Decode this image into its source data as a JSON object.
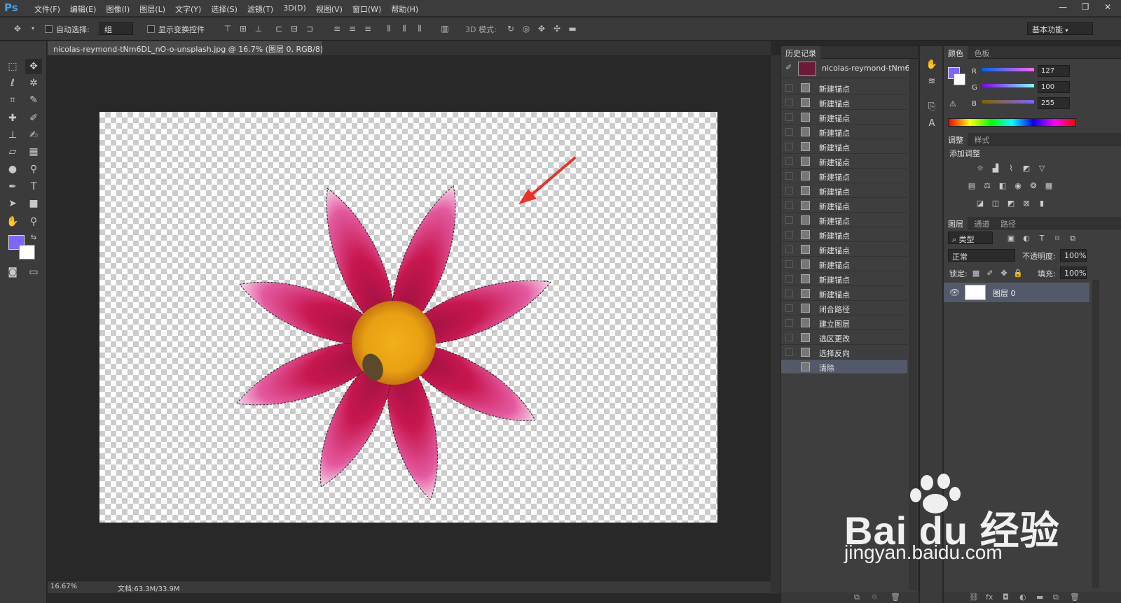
{
  "app": {
    "logo": "Ps"
  },
  "menu": [
    "文件(F)",
    "编辑(E)",
    "图像(I)",
    "图层(L)",
    "文字(Y)",
    "选择(S)",
    "滤镜(T)",
    "3D(D)",
    "视图(V)",
    "窗口(W)",
    "帮助(H)"
  ],
  "window_controls": {
    "minimize": "—",
    "restore": "❐",
    "close": "✕"
  },
  "options": {
    "auto_select_label": "自动选择:",
    "auto_select_value": "组",
    "show_transform_label": "显示变换控件",
    "mode_3d_label": "3D 模式:",
    "workspace": "基本功能"
  },
  "document": {
    "tab_title": "nicolas-reymond-tNm6DL_nO-o-unsplash.jpg @ 16.7% (图层 0, RGB/8) *",
    "tab_close": "×",
    "zoom": "16.67%",
    "doc_size": "文档:63.3M/33.9M"
  },
  "history": {
    "tab": "历史记录",
    "snapshot_name": "nicolas-reymond-tNm6...",
    "items": [
      "新建锚点",
      "新建锚点",
      "新建锚点",
      "新建锚点",
      "新建锚点",
      "新建锚点",
      "新建锚点",
      "新建锚点",
      "新建锚点",
      "新建锚点",
      "新建锚点",
      "新建锚点",
      "新建锚点",
      "新建锚点",
      "新建锚点",
      "闭合路径",
      "建立图层",
      "选区更改",
      "选择反向",
      "清除"
    ],
    "selected_index": 19
  },
  "color_panel": {
    "tabs": [
      "颜色",
      "色板"
    ],
    "r_label": "R",
    "g_label": "G",
    "b_label": "B",
    "r": "127",
    "g": "100",
    "b": "255",
    "fg_color": "#7f64ff"
  },
  "adjustments": {
    "tabs": [
      "调整",
      "样式"
    ],
    "title": "添加调整"
  },
  "layers": {
    "tabs": [
      "图层",
      "通道",
      "路径"
    ],
    "filter": "类型",
    "blend_mode": "正常",
    "opacity_label": "不透明度:",
    "opacity": "100%",
    "lock_label": "锁定:",
    "fill_label": "填充:",
    "fill": "100%",
    "layer_name": "图层 0"
  },
  "watermark": {
    "brand": "Bai du 经验",
    "url": "jingyan.baidu.com"
  }
}
